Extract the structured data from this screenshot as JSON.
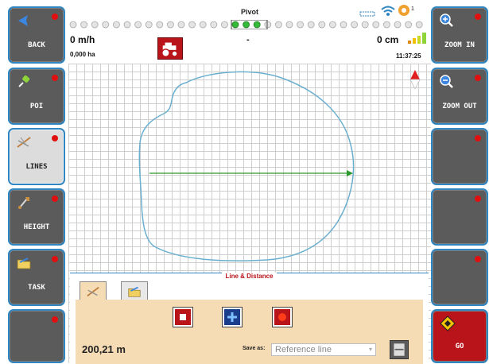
{
  "left_buttons": [
    {
      "id": "back",
      "label": "BACK",
      "icon": "back-arrow-icon"
    },
    {
      "id": "poi",
      "label": "POI",
      "icon": "pin-icon"
    },
    {
      "id": "lines",
      "label": "LINES",
      "icon": "lines-icon",
      "active": true
    },
    {
      "id": "height",
      "label": "HEIGHT",
      "icon": "shovel-icon"
    },
    {
      "id": "task",
      "label": "TASK",
      "icon": "folder-icon"
    },
    {
      "id": "empty-left",
      "label": ""
    }
  ],
  "right_buttons": [
    {
      "id": "zoom-in",
      "label": "ZOOM IN",
      "icon": "zoom-in-icon"
    },
    {
      "id": "zoom-out",
      "label": "ZOOM OUT",
      "icon": "zoom-out-icon"
    },
    {
      "id": "empty-right-1",
      "label": ""
    },
    {
      "id": "empty-right-2",
      "label": ""
    },
    {
      "id": "empty-right-3",
      "label": ""
    },
    {
      "id": "go",
      "label": "GO",
      "icon": "go-icon"
    }
  ],
  "status": {
    "mode": "Pivot",
    "speed": "0 m/h",
    "area": "0,000 ha",
    "center_value": "-",
    "offset": "0 cm",
    "time": "11:37:25",
    "badge": "1"
  },
  "panel": {
    "title": "Line & Distance",
    "distance": "200,21 m",
    "save_as_label": "Save as:",
    "save_as_value": "Reference line"
  },
  "colors": {
    "accent": "#2f86c0",
    "alert": "#b8141a",
    "panel_bg": "#f6dcb5",
    "boundary": "#6aafd0",
    "line": "#2a9a2a"
  }
}
